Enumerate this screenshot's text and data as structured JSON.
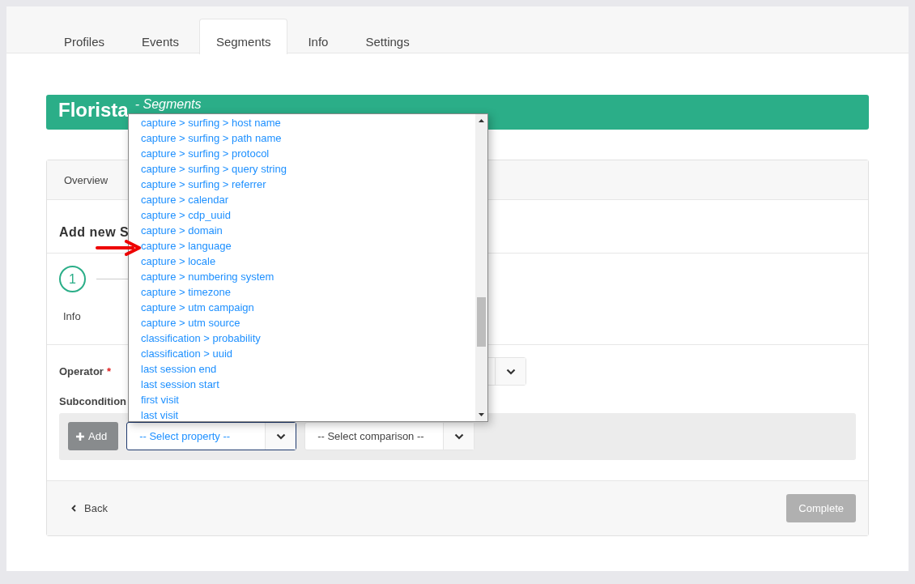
{
  "tabs": [
    {
      "label": "Profiles",
      "selected": false
    },
    {
      "label": "Events",
      "selected": false
    },
    {
      "label": "Segments",
      "selected": true
    },
    {
      "label": "Info",
      "selected": false
    },
    {
      "label": "Settings",
      "selected": false
    }
  ],
  "header": {
    "title": "Florista",
    "subtitle": "- Segments"
  },
  "panel": {
    "tab": "Overview",
    "section_title": "Add new S",
    "steps": [
      {
        "number": "1",
        "label": "Info",
        "active": true
      }
    ],
    "operator": {
      "label": "Operator",
      "required_mark": "*"
    },
    "subconditions": {
      "label": "Subcondition",
      "add_button": "Add",
      "property_select": {
        "text": "-- Select property --",
        "focused": true
      },
      "comparison_select": {
        "text": "-- Select comparison --",
        "focused": false
      }
    },
    "footer": {
      "back": "Back",
      "complete": {
        "label": "Complete",
        "disabled": true
      }
    }
  },
  "dropdown": {
    "options": [
      {
        "label": "capture > surfing > host name"
      },
      {
        "label": "capture > surfing > path name"
      },
      {
        "label": "capture > surfing > protocol"
      },
      {
        "label": "capture > surfing > query string"
      },
      {
        "label": "capture > surfing > referrer"
      },
      {
        "label": "capture > calendar"
      },
      {
        "label": "capture > cdp_uuid"
      },
      {
        "label": "capture > domain"
      },
      {
        "label": "capture > language"
      },
      {
        "label": "capture > locale"
      },
      {
        "label": "capture > numbering system"
      },
      {
        "label": "capture > timezone"
      },
      {
        "label": "capture > utm campaign"
      },
      {
        "label": "capture > utm source"
      },
      {
        "label": "classification > probability"
      },
      {
        "label": "classification > uuid"
      },
      {
        "label": "last session end"
      },
      {
        "label": "last session start"
      },
      {
        "label": "first visit"
      },
      {
        "label": "last visit"
      }
    ]
  }
}
